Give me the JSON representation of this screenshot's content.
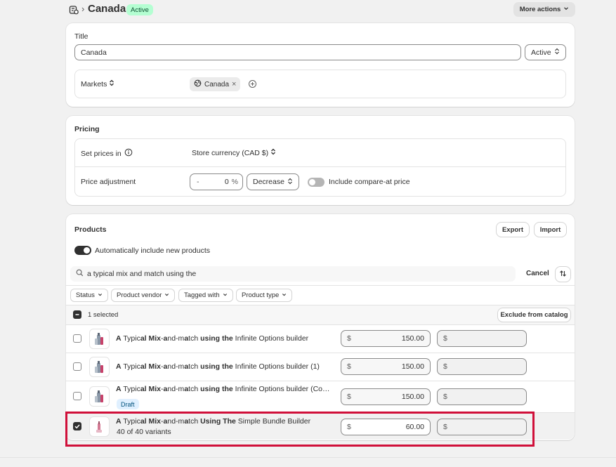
{
  "header": {
    "title": "Canada",
    "status_badge": "Active",
    "more_actions": "More actions",
    "breadcrumb_sep": "›"
  },
  "details": {
    "title_label": "Title",
    "title_value": "Canada",
    "status_select": "Active",
    "markets_label": "Markets",
    "market_chip": "Canada",
    "market_chip_remove": "×"
  },
  "pricing": {
    "heading": "Pricing",
    "set_prices_label": "Set prices in",
    "currency_select": "Store currency (CAD $)",
    "adjustment_label": "Price adjustment",
    "adj_sign": "-",
    "adj_value": "0",
    "adj_unit": "%",
    "adj_direction": "Decrease",
    "compare_at_label": "Include compare-at price"
  },
  "products": {
    "heading": "Products",
    "export_label": "Export",
    "import_label": "Import",
    "auto_include_label": "Automatically include new products",
    "search_value": "a typical mix and match using the",
    "cancel_label": "Cancel",
    "filters": [
      "Status",
      "Product vendor",
      "Tagged with",
      "Product type"
    ],
    "selected_count": "1 selected",
    "exclude_label": "Exclude from catalog",
    "rows": [
      {
        "name_parts": [
          "A",
          " Typic",
          "al",
          " ",
          "Mix",
          "-",
          "a",
          "nd-m",
          "a",
          "tch ",
          "using the",
          " Infinite Options builder"
        ],
        "currency": "$",
        "price": "150.00",
        "compare_currency": "$",
        "badge": "",
        "variants": ""
      },
      {
        "name_parts": [
          "A",
          " Typic",
          "al",
          " ",
          "Mix",
          "-",
          "a",
          "nd-m",
          "a",
          "tch ",
          "using the",
          " Infinite Options builder (1)"
        ],
        "currency": "$",
        "price": "150.00",
        "compare_currency": "$",
        "badge": "",
        "variants": ""
      },
      {
        "name_parts": [
          "A",
          " Typic",
          "al",
          " ",
          "Mix",
          "-",
          "a",
          "nd-m",
          "a",
          "tch ",
          "using the",
          " Infinite Options builder (Co…"
        ],
        "currency": "$",
        "price": "150.00",
        "compare_currency": "$",
        "badge": "Draft",
        "variants": ""
      },
      {
        "name_parts": [
          "A",
          " Typic",
          "al",
          " ",
          "Mix",
          "-",
          "a",
          "nd-m",
          "a",
          "tch ",
          "Using The",
          " Simple Bundle Builder"
        ],
        "currency": "$",
        "price": "60.00",
        "compare_currency": "$",
        "badge": "",
        "variants": "40 of 40 variants"
      }
    ]
  },
  "colors": {
    "active_badge_bg": "#b4fed2",
    "active_badge_text": "#0c5132",
    "draft_badge_bg": "#e0f0ff",
    "draft_badge_text": "#00527c",
    "highlight_border": "#d0103a",
    "toggle_on": "#303030",
    "toggle_off": "#b5b5b5"
  },
  "icons": {
    "catalog": "catalog-icon",
    "info": "info-icon",
    "globe": "globe-icon",
    "add": "plus-circle-icon",
    "search": "search-icon",
    "sort": "sort-icon",
    "chevron": "chevron-down-icon",
    "selector": "selector-icon"
  }
}
